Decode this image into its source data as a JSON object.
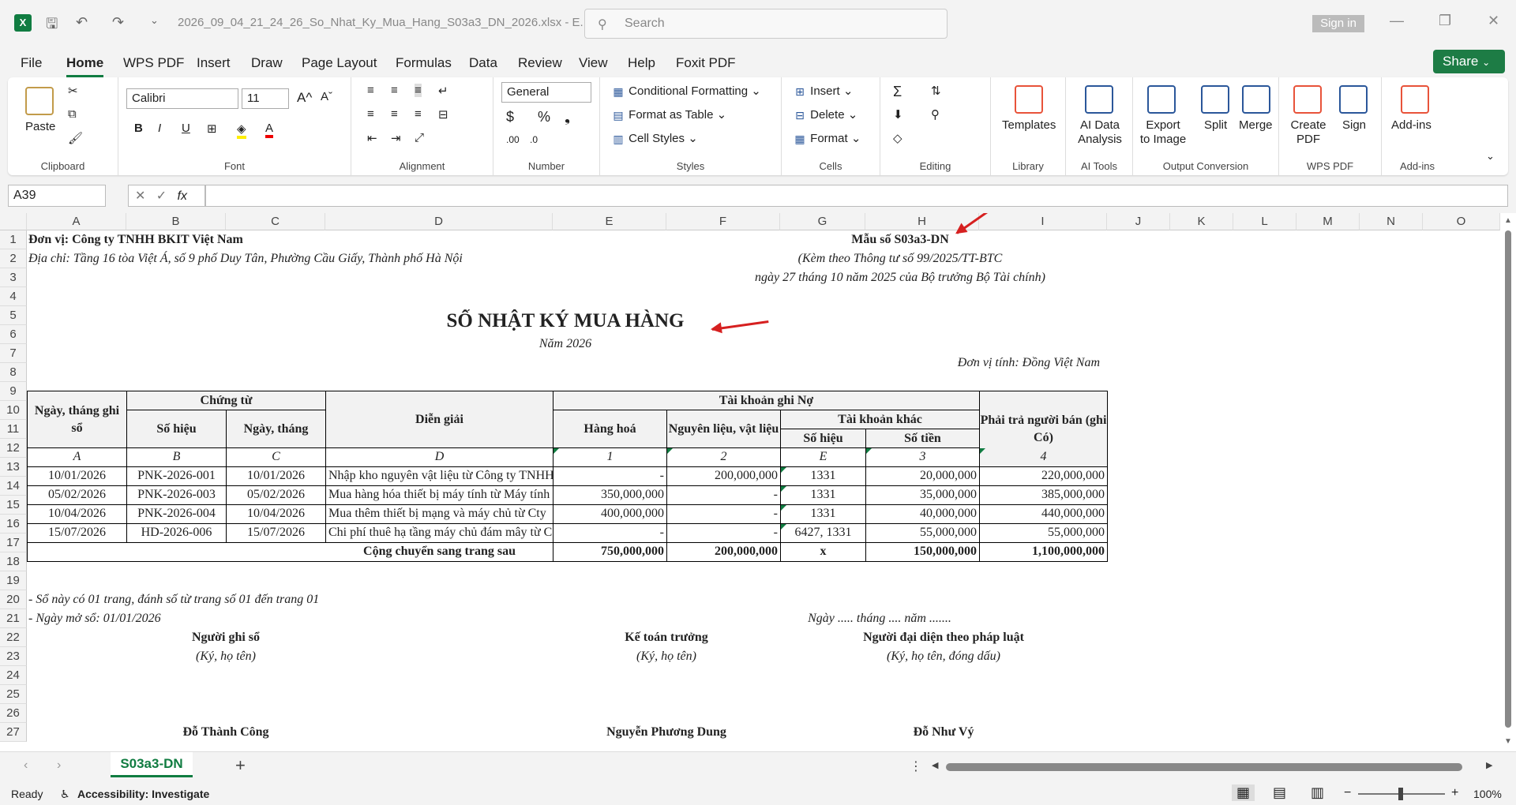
{
  "titlebar": {
    "app_icon": "X",
    "filename": "2026_09_04_21_24_26_So_Nhat_Ky_Mua_Hang_S03a3_DN_2026.xlsx - E...",
    "search_placeholder": "Search",
    "signin": "Sign in"
  },
  "menus": [
    "File",
    "Home",
    "WPS PDF",
    "Insert",
    "Draw",
    "Page Layout",
    "Formulas",
    "Data",
    "Review",
    "View",
    "Help",
    "Foxit PDF"
  ],
  "share_label": "Share",
  "ribbon": {
    "clipboard": {
      "paste": "Paste",
      "label": "Clipboard"
    },
    "font": {
      "name": "Calibri",
      "size": "11",
      "bold": "B",
      "italic": "I",
      "underline": "U",
      "label": "Font"
    },
    "alignment": {
      "label": "Alignment"
    },
    "number": {
      "format": "General",
      "label": "Number"
    },
    "styles": {
      "cond": "Conditional Formatting",
      "table": "Format as Table",
      "cell": "Cell Styles",
      "label": "Styles"
    },
    "cells": {
      "insert": "Insert",
      "delete": "Delete",
      "format": "Format",
      "label": "Cells"
    },
    "editing": {
      "label": "Editing"
    },
    "library": {
      "templates": "Templates",
      "label": "Library"
    },
    "aitools": {
      "ai": "AI Data Analysis",
      "label": "AI Tools"
    },
    "output": {
      "export": "Export to Image",
      "split": "Split",
      "merge": "Merge",
      "label": "Output Conversion"
    },
    "wpspdf": {
      "create": "Create PDF",
      "sign": "Sign",
      "label": "WPS PDF"
    },
    "addins": {
      "addins": "Add-ins",
      "label": "Add-ins"
    }
  },
  "formula": {
    "namebox": "A39",
    "fx": "fx"
  },
  "columns": [
    "A",
    "B",
    "C",
    "D",
    "E",
    "F",
    "G",
    "H",
    "I",
    "J",
    "K",
    "L",
    "M",
    "N",
    "O"
  ],
  "rows": [
    "1",
    "2",
    "3",
    "4",
    "5",
    "6",
    "7",
    "8",
    "9",
    "10",
    "11",
    "12",
    "13",
    "14",
    "15",
    "16",
    "17",
    "18",
    "19",
    "20",
    "21",
    "22",
    "23",
    "24",
    "25",
    "26",
    "27"
  ],
  "doc": {
    "unit": "Đơn vị: Công ty TNHH BKIT Việt Nam",
    "address": "Địa chỉ: Tầng 16 tòa Việt Á, số 9 phố Duy Tân, Phường Cầu Giấy, Thành phố Hà Nội",
    "form": "Mẫu số S03a3-DN",
    "circular": "(Kèm theo Thông tư số 99/2025/TT-BTC",
    "circular2": "ngày 27 tháng 10 năm 2025 của Bộ trưởng Bộ Tài chính)",
    "title": "SỔ NHẬT KÝ MUA HÀNG",
    "year": "Năm 2026",
    "currency": "Đơn vị tính: Đồng Việt Nam",
    "h_date": "Ngày, tháng ghi sổ",
    "h_voucher": "Chứng từ",
    "h_no": "Số hiệu",
    "h_vdate": "Ngày, tháng",
    "h_desc": "Diễn giải",
    "h_debit": "Tài khoản ghi Nợ",
    "h_goods": "Hàng hoá",
    "h_material": "Nguyên liệu, vật liệu",
    "h_other": "Tài khoản khác",
    "h_acc": "Số hiệu",
    "h_amount": "Số tiền",
    "h_payable": "Phải trả người bán (ghi Có)",
    "codes": [
      "A",
      "B",
      "C",
      "D",
      "1",
      "2",
      "E",
      "3",
      "4"
    ],
    "entries": [
      [
        "10/01/2026",
        "PNK-2026-001",
        "10/01/2026",
        "Nhập kho nguyên vật liệu từ Công ty TNHH",
        "-",
        "200,000,000",
        "1331",
        "20,000,000",
        "220,000,000"
      ],
      [
        "05/02/2026",
        "PNK-2026-003",
        "05/02/2026",
        "Mua hàng hóa thiết bị máy tính từ Máy tính",
        "350,000,000",
        "-",
        "1331",
        "35,000,000",
        "385,000,000"
      ],
      [
        "10/04/2026",
        "PNK-2026-004",
        "10/04/2026",
        "Mua thêm thiết bị mạng và máy chủ từ Cty",
        "400,000,000",
        "-",
        "1331",
        "40,000,000",
        "440,000,000"
      ],
      [
        "15/07/2026",
        "HD-2026-006",
        "15/07/2026",
        "Chi phí thuê hạ tầng máy chủ đám mây từ C",
        "-",
        "-",
        "6427, 1331",
        "55,000,000",
        "55,000,000"
      ]
    ],
    "total": [
      "Cộng chuyển sang trang sau",
      "750,000,000",
      "200,000,000",
      "x",
      "150,000,000",
      "1,100,000,000"
    ],
    "note1": "- Sổ này có 01 trang, đánh số từ trang số 01 đến trang 01",
    "note2": "- Ngày mở sổ: 01/01/2026",
    "datefill": "Ngày ..... tháng .... năm .......",
    "sig1": "Người ghi sổ",
    "sig2": "Kế toán trưởng",
    "sig3": "Người đại diện theo pháp luật",
    "sig1sub": "(Ký, họ tên)",
    "sig2sub": "(Ký, họ tên)",
    "sig3sub": "(Ký, họ tên, đóng dấu)",
    "name1": "Đỗ Thành Công",
    "name2": "Nguyễn Phương Dung",
    "name3": "Đỗ Như Vý"
  },
  "sheet_tab": "S03a3-DN",
  "status": {
    "ready": "Ready",
    "accessibility": "Accessibility: Investigate",
    "zoom": "100%"
  }
}
